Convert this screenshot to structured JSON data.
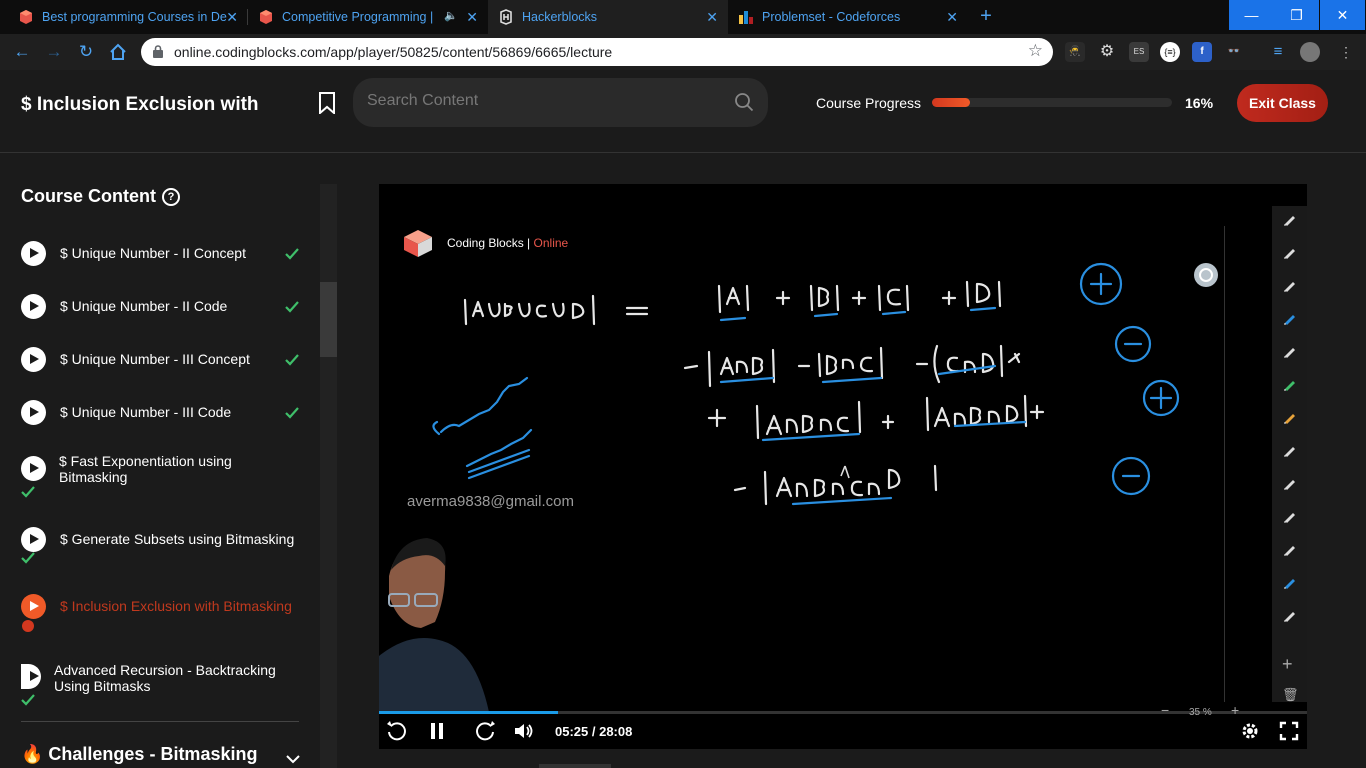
{
  "browser": {
    "tabs": [
      {
        "title": "Best programming Courses in De",
        "favicon": "coding-blocks-cube",
        "color": "#e8564b"
      },
      {
        "title": "Competitive Programming | ",
        "favicon": "coding-blocks-cube",
        "color": "#e8564b"
      },
      {
        "title": "Hackerblocks",
        "favicon": "hackerblocks-logo",
        "color": "#dddddd"
      },
      {
        "title": "Problemset - Codeforces",
        "favicon": "codeforces-bars",
        "color": "#f6c343"
      }
    ],
    "url": "online.codingblocks.com/app/player/50825/content/56869/6665/lecture",
    "window_buttons": [
      "—",
      "❐",
      "✕"
    ]
  },
  "header": {
    "lecture_title": "$ Inclusion Exclusion with",
    "search_placeholder": "Search Content",
    "progress_label": "Course Progress",
    "progress_value": 0.16,
    "progress_text": "16%",
    "exit_label": "Exit Class"
  },
  "sidebar": {
    "heading": "Course Content",
    "help": "?",
    "items": [
      {
        "label": "$ Unique Number - II Concept",
        "completed": true
      },
      {
        "label": "$ Unique Number - II Code",
        "completed": true
      },
      {
        "label": "$ Unique Number - III Concept",
        "completed": true
      },
      {
        "label": "$ Unique Number - III Code",
        "completed": true
      },
      {
        "label": "$ Fast Exponentiation using Bitmasking",
        "completed": true
      },
      {
        "label": "$ Generate Subsets using Bitmasking",
        "completed": true
      },
      {
        "label": "$ Inclusion Exclusion with Bitmasking",
        "completed": false,
        "current": true
      },
      {
        "label": "Advanced Recursion - Backtracking Using Bitmasks",
        "completed": true
      }
    ],
    "section_title": "🔥 Challenges - Bitmasking"
  },
  "player": {
    "brand_name": "Coding Blocks",
    "brand_separator": " | ",
    "brand_suffix": "Online",
    "watermark": "averma9838@gmail.com",
    "time": "05:25 / 28:08",
    "zoom_minus": "−",
    "zoom_level": "35 %",
    "zoom_plus": "+",
    "played_fraction": 0.193
  },
  "colors": {
    "accent": "#f05a28",
    "exit": "#b3231a",
    "check": "#3fbf6a",
    "link_blue": "#4ea3f1",
    "ink_blue": "#2a8fe0"
  }
}
